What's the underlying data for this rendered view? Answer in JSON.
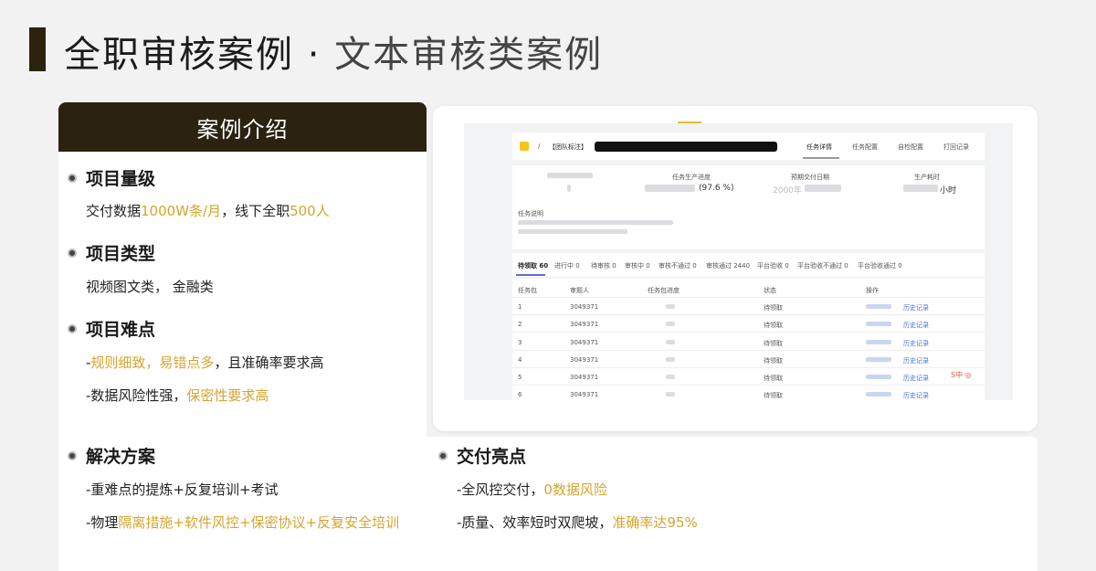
{
  "title": {
    "main": "全职审核案例",
    "separator": "·",
    "sub": "文本审核类案例"
  },
  "intro": {
    "header": "案例介绍"
  },
  "sections": {
    "scale": {
      "title": "项目量级",
      "l1_a": "交付数据",
      "l1_b": "1000W条/月",
      "l1_c": "，线下全职",
      "l1_d": "500人"
    },
    "type": {
      "title": "项目类型",
      "line": "视频图文类， 金融类"
    },
    "difficulty": {
      "title": "项目难点",
      "l1_a": "-",
      "l1_b": "规则细致，易错点多",
      "l1_c": "，且准确率要求高",
      "l2_a": "-数据风险性强，",
      "l2_b": "保密性要求高"
    },
    "solution": {
      "title": "解决方案",
      "l1": "-重难点的提炼+反复培训+考试",
      "l2_a": "-物理",
      "l2_b": "隔离措施+软件风控+保密协议+反复安全培训"
    },
    "highlights": {
      "title": "交付亮点",
      "l1_a": "-全风控交付，",
      "l1_b": "0数据风险",
      "l2_a": "-质量、效率短时双爬坡，",
      "l2_b": "准确率达95%"
    }
  },
  "screenshot": {
    "breadcrumb_sep": "/",
    "project": "【团队标注】",
    "top_tabs": [
      "任务详情",
      "任务配置",
      "自检配置",
      "打回记录"
    ],
    "stats": [
      {
        "label": "任务生产进度",
        "value": "(97.6 %)"
      },
      {
        "label": "预期交付日期",
        "value": "2000年"
      },
      {
        "label": "生产耗时",
        "value": "小时"
      }
    ],
    "desc_label": "任务说明",
    "status_tabs": [
      "待领取 60",
      "进行中 0",
      "待审核 0",
      "审核中 0",
      "审核不通过 0",
      "审核通过 2440",
      "平台验收 0",
      "平台验收不通过 0",
      "平台验收通过 0"
    ],
    "columns": [
      "任务包",
      "审题人",
      "任务包进度",
      "状态",
      "操作"
    ],
    "rows": [
      {
        "id": "1",
        "reviewer": "3049371",
        "status": "待领取",
        "action": "历史记录"
      },
      {
        "id": "2",
        "reviewer": "3049371",
        "status": "待领取",
        "action": "历史记录"
      },
      {
        "id": "3",
        "reviewer": "3049371",
        "status": "待领取",
        "action": "历史记录"
      },
      {
        "id": "4",
        "reviewer": "3049371",
        "status": "待领取",
        "action": "历史记录"
      },
      {
        "id": "5",
        "reviewer": "3049371",
        "status": "待领取",
        "action": "历史记录"
      },
      {
        "id": "6",
        "reviewer": "3049371",
        "status": "待领取",
        "action": "历史记录"
      }
    ],
    "ime_bar": "S中·◎"
  },
  "colors": {
    "accent": "#d5a52f",
    "dark": "#2b2310"
  }
}
